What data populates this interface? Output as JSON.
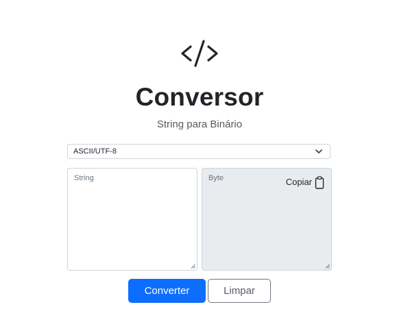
{
  "header": {
    "logo_icon": "code-icon",
    "title": "Conversor",
    "subtitle": "String para Binário"
  },
  "encoding": {
    "selected": "ASCII/UTF-8",
    "icon": "chevron-down-icon"
  },
  "input": {
    "placeholder": "String",
    "value": ""
  },
  "output": {
    "placeholder": "Byte",
    "value": "",
    "copy_label": "Copiar",
    "copy_icon": "clipboard-icon"
  },
  "actions": {
    "convert_label": "Converter",
    "clear_label": "Limpar"
  },
  "colors": {
    "primary": "#0d6efd",
    "text": "#212529",
    "readonly_background": "#e9ecef",
    "border": "#ced4da"
  }
}
